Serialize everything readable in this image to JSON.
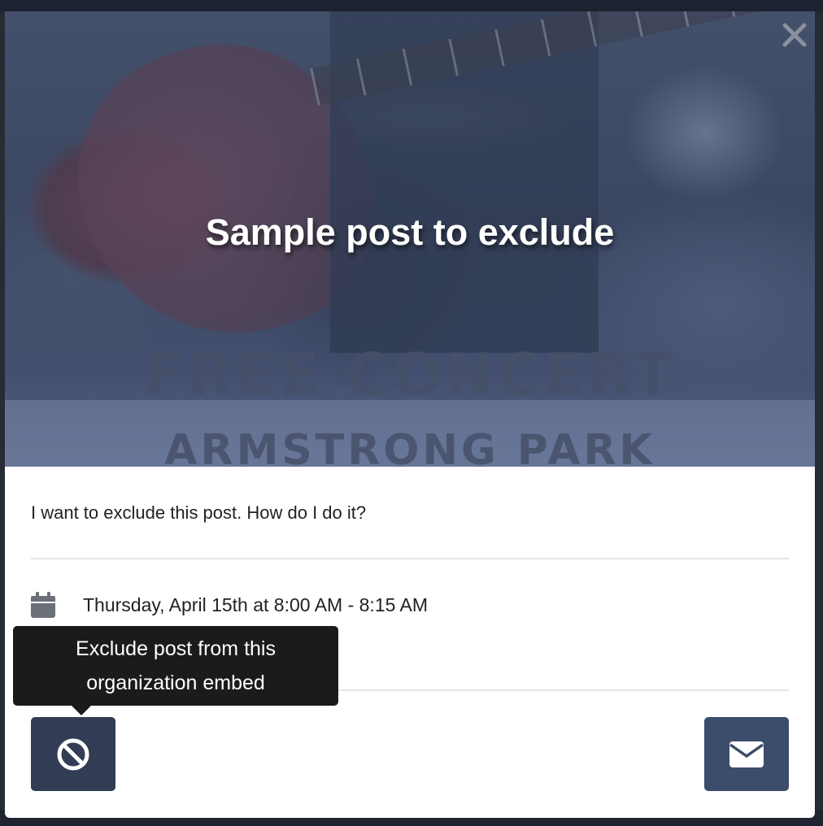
{
  "post": {
    "title": "Sample post to exclude",
    "description": "I want to exclude this post. How do I do it?",
    "date_time": "Thursday, April 15th at 8:00 AM - 8:15 AM"
  },
  "hero_image": {
    "poster_line_1": "FREE CONCERT",
    "poster_line_2": "ARMSTRONG PARK"
  },
  "tooltip": {
    "line1": "Exclude post from this",
    "line2": "organization embed"
  },
  "icons": {
    "close": "close-icon",
    "calendar": "calendar-icon",
    "location": "map-pin-icon",
    "exclude": "ban-icon",
    "email": "envelope-icon"
  },
  "colors": {
    "exclude_button": "#323d55",
    "email_button": "#3c4c6b",
    "tooltip_bg": "#1b1b1d",
    "icon_gray": "#6b6f78"
  }
}
